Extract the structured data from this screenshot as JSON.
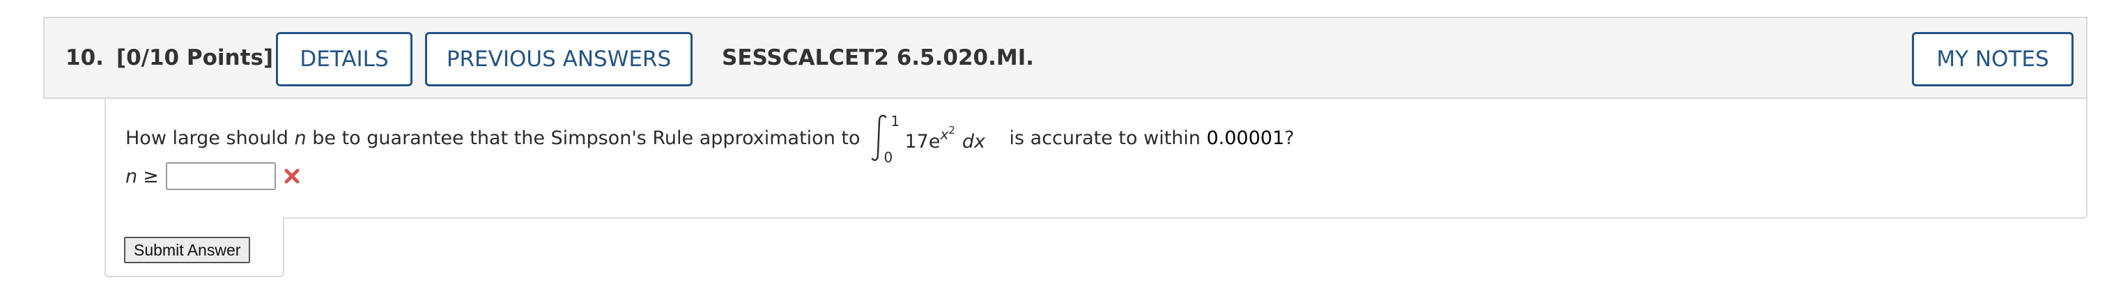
{
  "header": {
    "question_number": "10.",
    "points": "[0/10 Points]",
    "details_label": "DETAILS",
    "previous_answers_label": "PREVIOUS ANSWERS",
    "source_code": "SESSCALCET2 6.5.020.MI.",
    "my_notes_label": "MY NOTES"
  },
  "question": {
    "text_before_var": "How large should",
    "variable": "n",
    "text_after_var": "be to guarantee that the Simpson's Rule approximation to",
    "integral": {
      "upper_limit": "1",
      "lower_limit": "0",
      "coefficient": "17e",
      "exponent_base": "x",
      "exponent_power": "2",
      "differential": "dx"
    },
    "text_after_integral": "is accurate to within",
    "tolerance": "0.00001",
    "question_mark": "?"
  },
  "answer": {
    "label_var": "n",
    "label_symbol": "≥",
    "value": "",
    "status": "incorrect",
    "status_color": "#d9534f"
  },
  "submit": {
    "label": "Submit Answer"
  },
  "colors": {
    "accent": "#235486",
    "header_bg": "#f5f5f5",
    "border": "#d9d9d9"
  }
}
